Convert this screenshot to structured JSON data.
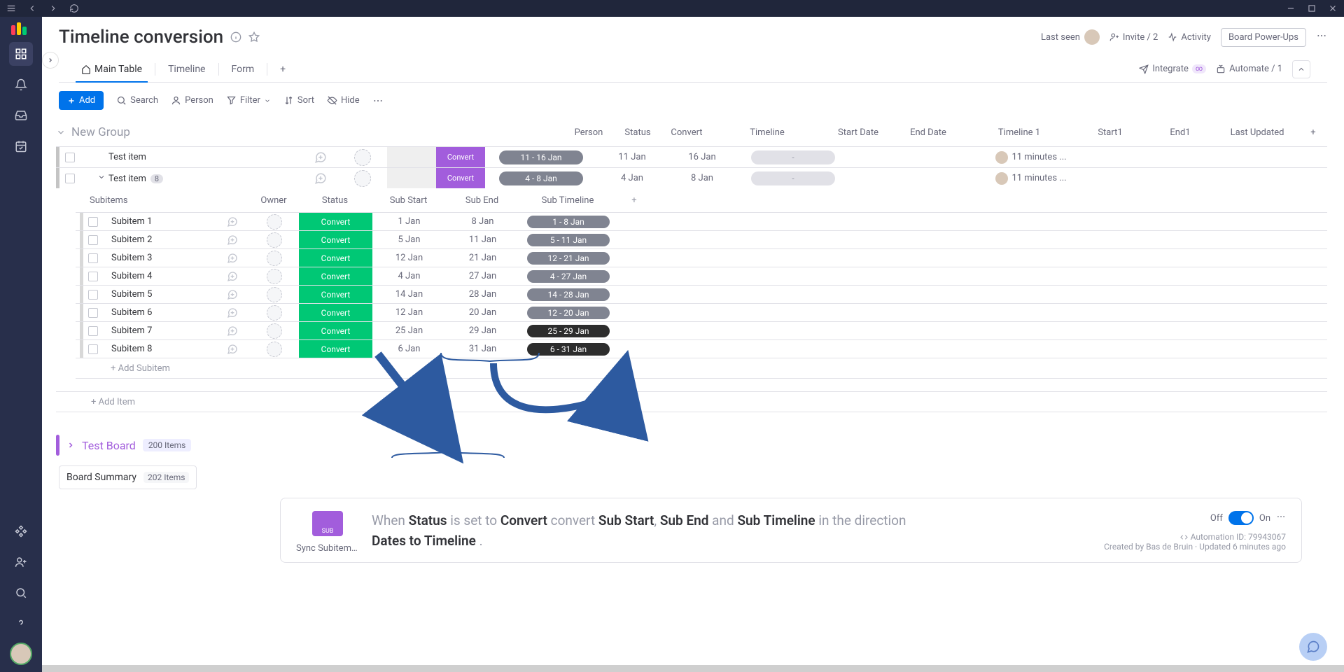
{
  "board": {
    "title": "Timeline conversion"
  },
  "header": {
    "last_seen": "Last seen",
    "invite": "Invite / 2",
    "activity": "Activity",
    "powerups": "Board Power-Ups"
  },
  "tabs": {
    "main_table": "Main Table",
    "timeline": "Timeline",
    "form": "Form",
    "integrate": "Integrate",
    "automate": "Automate / 1"
  },
  "toolbar": {
    "add": "Add",
    "search": "Search",
    "person": "Person",
    "filter": "Filter",
    "sort": "Sort",
    "hide": "Hide"
  },
  "group1": {
    "name": "New Group",
    "columns": {
      "person": "Person",
      "status": "Status",
      "convert": "Convert",
      "timeline": "Timeline",
      "start_date": "Start Date",
      "end_date": "End Date",
      "timeline1": "Timeline 1",
      "start1": "Start1",
      "end1": "End1",
      "last_updated": "Last Updated"
    },
    "items": [
      {
        "name": "Test item",
        "convert": "Convert",
        "timeline": "11 - 16 Jan",
        "start": "11 Jan",
        "end": "16 Jan",
        "timeline1": "-",
        "updated": "11 minutes ..."
      },
      {
        "name": "Test item",
        "badge": "8",
        "convert": "Convert",
        "timeline": "4 - 8 Jan",
        "start": "4 Jan",
        "end": "8 Jan",
        "timeline1": "-",
        "updated": "11 minutes ..."
      }
    ],
    "add_item": "+ Add Item"
  },
  "subitems": {
    "title": "Subitems",
    "columns": {
      "owner": "Owner",
      "status": "Status",
      "substart": "Sub Start",
      "subend": "Sub End",
      "subtimeline": "Sub Timeline"
    },
    "rows": [
      {
        "name": "Subitem 1",
        "status": "Convert",
        "start": "1 Jan",
        "end": "8 Jan",
        "timeline": "1 - 8 Jan",
        "fill": 1.0,
        "dark": false
      },
      {
        "name": "Subitem 2",
        "status": "Convert",
        "start": "5 Jan",
        "end": "11 Jan",
        "timeline": "5 - 11 Jan",
        "fill": 1.0,
        "dark": false
      },
      {
        "name": "Subitem 3",
        "status": "Convert",
        "start": "12 Jan",
        "end": "21 Jan",
        "timeline": "12 - 21 Jan",
        "fill": 1.0,
        "dark": false
      },
      {
        "name": "Subitem 4",
        "status": "Convert",
        "start": "4 Jan",
        "end": "27 Jan",
        "timeline": "4 - 27 Jan",
        "fill": 0.82,
        "dark": true
      },
      {
        "name": "Subitem 5",
        "status": "Convert",
        "start": "14 Jan",
        "end": "28 Jan",
        "timeline": "14 - 28 Jan",
        "fill": 0.88,
        "dark": true
      },
      {
        "name": "Subitem 6",
        "status": "Convert",
        "start": "12 Jan",
        "end": "20 Jan",
        "timeline": "12 - 20 Jan",
        "fill": 1.0,
        "dark": false
      },
      {
        "name": "Subitem 7",
        "status": "Convert",
        "start": "25 Jan",
        "end": "29 Jan",
        "timeline": "25 - 29 Jan",
        "fill": 0.0,
        "dark": true
      },
      {
        "name": "Subitem 8",
        "status": "Convert",
        "start": "6 Jan",
        "end": "31 Jan",
        "timeline": "6 - 31 Jan",
        "fill": 0.0,
        "dark": true
      }
    ],
    "add_subitem": "+ Add Subitem"
  },
  "group2": {
    "name": "Test Board",
    "count": "200 Items"
  },
  "board_summary": {
    "label": "Board Summary",
    "count": "202 Items"
  },
  "automation": {
    "sub_badge": "SUB",
    "sync_label": "Sync Subitem T...",
    "sentence": {
      "p1": "When ",
      "b1": "Status",
      "p2": " is set to ",
      "b2": "Convert",
      "p3": " convert ",
      "b3": "Sub Start",
      "p4": ", ",
      "b4": "Sub End",
      "p5": " and ",
      "b5": "Sub Timeline",
      "p6": " in the direction ",
      "b6": "Dates to Timeline",
      "p7": " ."
    },
    "off": "Off",
    "on": "On",
    "meta_id": "Automation ID: 79943067",
    "meta_created": "Created by Bas de Bruin · Updated 6 minutes ago"
  }
}
